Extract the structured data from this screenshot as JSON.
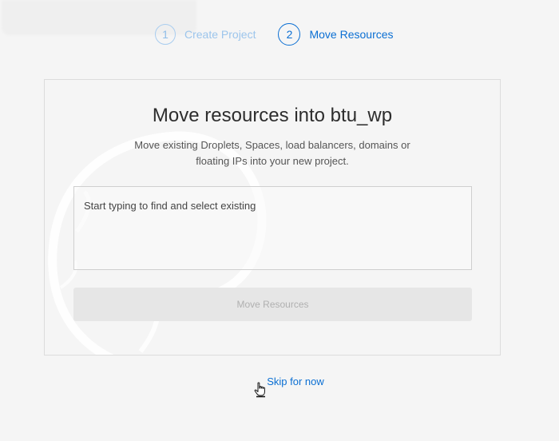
{
  "stepper": {
    "steps": [
      {
        "number": "1",
        "label": "Create Project",
        "state": "completed"
      },
      {
        "number": "2",
        "label": "Move Resources",
        "state": "active"
      }
    ]
  },
  "card": {
    "title": "Move resources into btu_wp",
    "description": "Move existing Droplets, Spaces, load balancers, domains or floating IPs into your new project.",
    "search_placeholder": "Start typing to find and select existing",
    "move_button_label": "Move Resources"
  },
  "footer": {
    "skip_label": "Skip for now"
  },
  "colors": {
    "accent": "#0b6fd3",
    "background": "#f5f5f5",
    "button_disabled_bg": "#e6e6e6",
    "button_disabled_text": "#b0b0b0"
  },
  "icons": {
    "cursor": "hand-pointer-icon",
    "watermark": "logo-watermark"
  }
}
